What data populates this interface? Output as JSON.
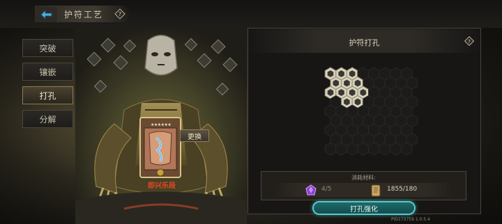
{
  "header": {
    "title": "护符工艺",
    "back_icon": "back-arrow-icon",
    "help_icon": "help-icon"
  },
  "sidebar": {
    "items": [
      {
        "label": "突破",
        "active": false
      },
      {
        "label": "镶嵌",
        "active": false
      },
      {
        "label": "打孔",
        "active": true
      },
      {
        "label": "分解",
        "active": false
      }
    ]
  },
  "card": {
    "name": "即兴乐段",
    "swap_label": "更换",
    "stars": "★★★★★★"
  },
  "panel": {
    "title": "护符打孔",
    "help_icon": "help-icon"
  },
  "materials": {
    "label": "消耗材料:",
    "items": [
      {
        "icon": "crystal-icon",
        "count": "4/5",
        "color": "#8a3fd1"
      },
      {
        "icon": "scroll-icon",
        "count": "1855/180"
      }
    ]
  },
  "action": {
    "label": "打孔强化"
  },
  "footer": {
    "pid": "PID173759 1.0.5.4"
  },
  "colors": {
    "accent": "#5fc7c6",
    "card_name": "#e04a25"
  }
}
